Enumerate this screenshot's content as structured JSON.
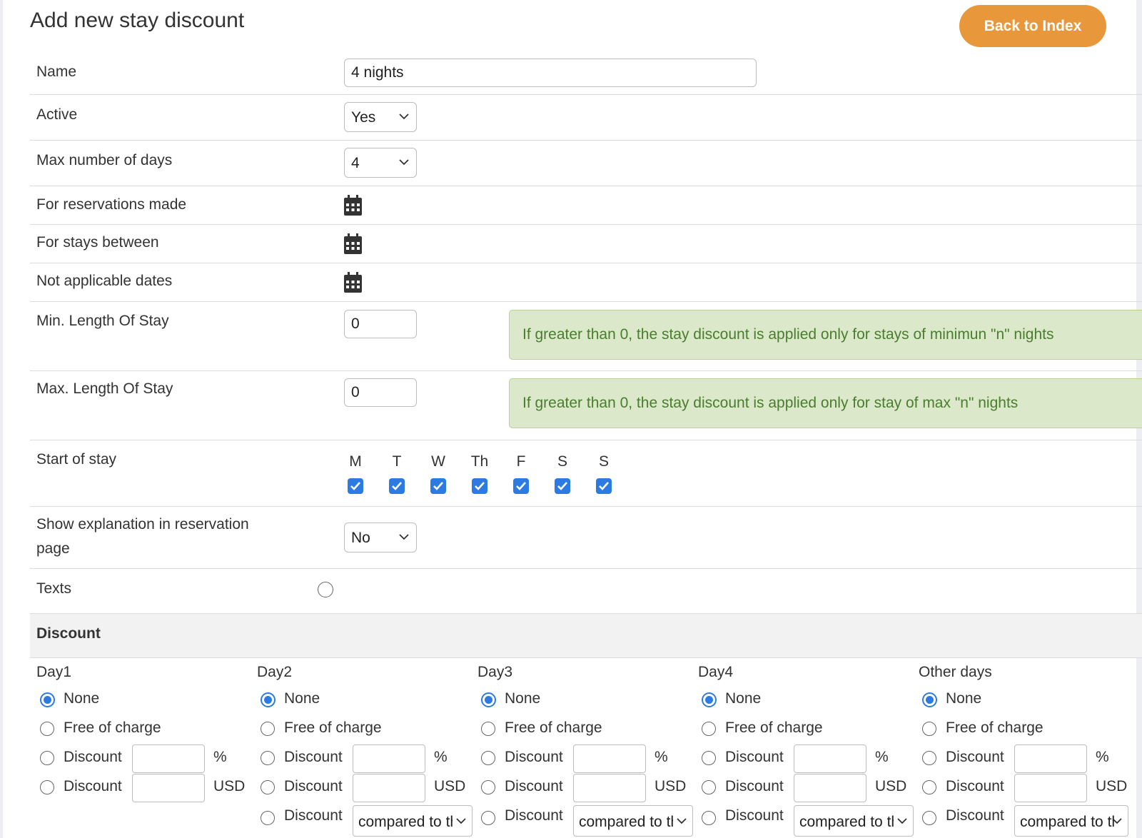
{
  "page": {
    "title": "Add new stay discount",
    "back_button": "Back to Index"
  },
  "form": {
    "name": {
      "label": "Name",
      "value": "4 nights"
    },
    "active": {
      "label": "Active",
      "value": "Yes"
    },
    "max_days": {
      "label": "Max number of days",
      "value": "4"
    },
    "reservations_made": {
      "label": "For reservations made"
    },
    "stays_between": {
      "label": "For stays between"
    },
    "not_applicable": {
      "label": "Not applicable dates"
    },
    "min_stay": {
      "label": "Min. Length Of Stay",
      "value": "0",
      "hint": "If greater than 0, the stay discount is applied only for stays of minimun \"n\" nights"
    },
    "max_stay": {
      "label": "Max. Length Of Stay",
      "value": "0",
      "hint": "If greater than 0, the stay discount is applied only for stay of max \"n\" nights"
    },
    "start_of_stay": {
      "label": "Start of stay",
      "days": [
        {
          "label": "M",
          "checked": true
        },
        {
          "label": "T",
          "checked": true
        },
        {
          "label": "W",
          "checked": true
        },
        {
          "label": "Th",
          "checked": true
        },
        {
          "label": "F",
          "checked": true
        },
        {
          "label": "S",
          "checked": true
        },
        {
          "label": "S",
          "checked": true
        }
      ]
    },
    "show_explanation": {
      "label_line1": "Show explanation in reservation",
      "label_line2": "page",
      "value": "No"
    },
    "texts": {
      "label": "Texts"
    }
  },
  "discount": {
    "header": "Discount",
    "none_label": "None",
    "free_label": "Free of charge",
    "discount_label": "Discount",
    "percent_unit": "%",
    "currency_unit": "USD",
    "compared_label": "compared to the",
    "columns": [
      {
        "title": "Day1",
        "selected": "None",
        "has_compare": false
      },
      {
        "title": "Day2",
        "selected": "None",
        "has_compare": true
      },
      {
        "title": "Day3",
        "selected": "None",
        "has_compare": true
      },
      {
        "title": "Day4",
        "selected": "None",
        "has_compare": true
      },
      {
        "title": "Other days",
        "selected": "None",
        "has_compare": true
      }
    ]
  },
  "colors": {
    "accent": "#e8983a",
    "checkbox": "#2b7be3",
    "hint_bg": "#dbe8c9",
    "hint_text": "#4a7d2f"
  }
}
